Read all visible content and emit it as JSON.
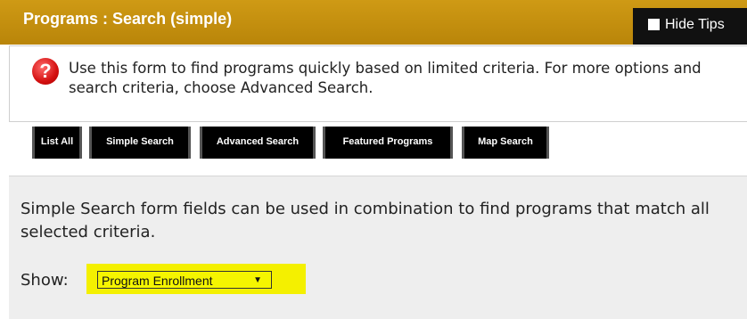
{
  "header": {
    "title": "Programs : Search (simple)",
    "hide_tips_label": "Hide Tips"
  },
  "tip": {
    "icon": "question-icon",
    "text": "Use this form to find programs quickly based on limited criteria. For more options and search criteria, choose Advanced Search."
  },
  "tabs": [
    {
      "label": "List All"
    },
    {
      "label": "Simple Search"
    },
    {
      "label": "Advanced Search"
    },
    {
      "label": "Featured Programs"
    },
    {
      "label": "Map Search"
    }
  ],
  "panel": {
    "description": "Simple Search form fields can be used in combination to find programs that match all selected criteria.",
    "show_label": "Show:",
    "show_select_value": "Program Enrollment"
  },
  "colors": {
    "header": "#c8920e",
    "tab": "#000000",
    "highlight": "#f4f000"
  }
}
